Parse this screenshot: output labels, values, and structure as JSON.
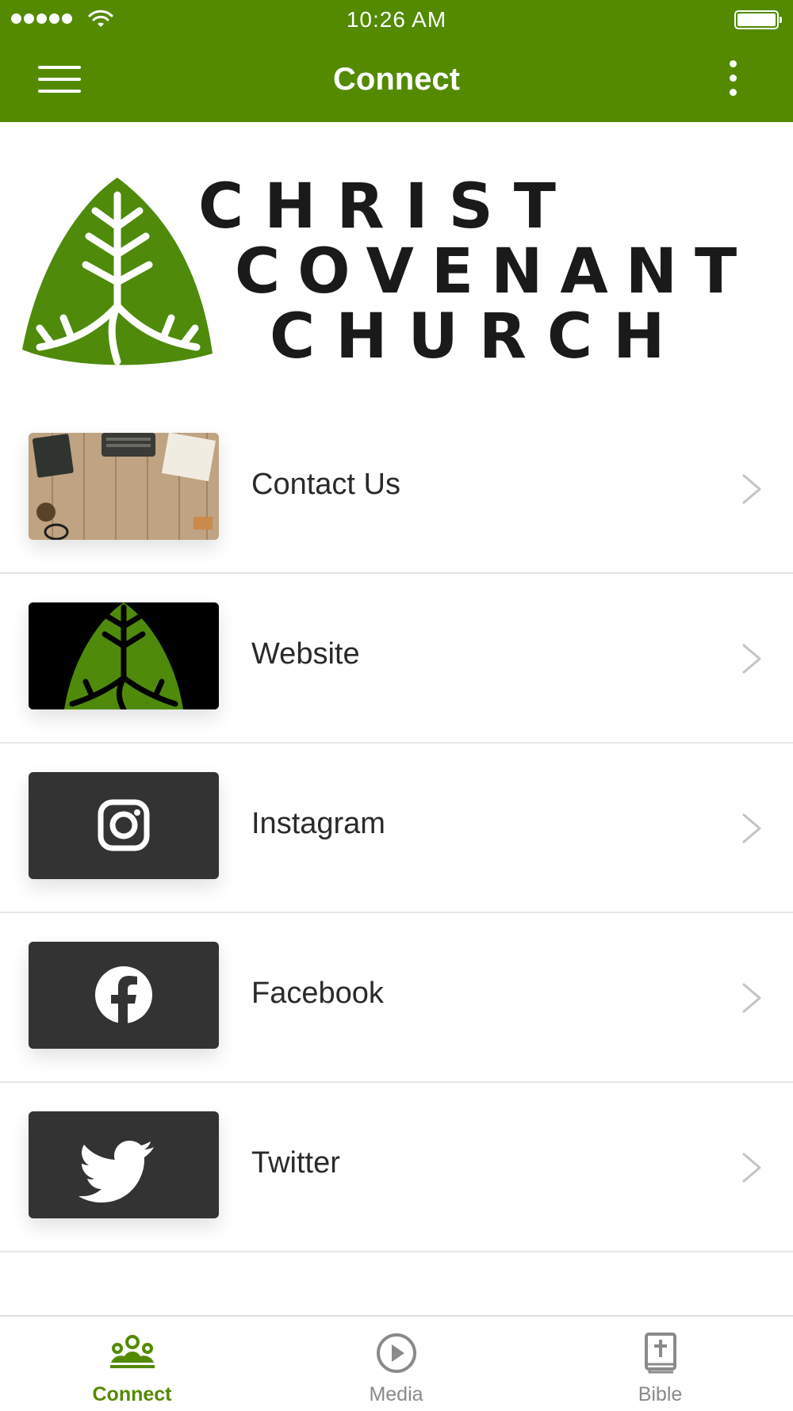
{
  "status_bar": {
    "time": "10:26 AM",
    "icons": [
      "signal-dots-icon",
      "wifi-icon",
      "battery-icon"
    ]
  },
  "header": {
    "title": "Connect",
    "left_icon": "menu-icon",
    "right_icon": "more-vertical-icon",
    "background_color": "#538a00"
  },
  "logo": {
    "words": [
      "CHRIST",
      "COVENANT",
      "CHURCH"
    ],
    "accent_color": "#4f8a0b"
  },
  "list": {
    "items": [
      {
        "label": "Contact Us",
        "thumbnail": "desk-photo"
      },
      {
        "label": "Website",
        "thumbnail": "leaf-logo"
      },
      {
        "label": "Instagram",
        "thumbnail": "instagram-icon"
      },
      {
        "label": "Facebook",
        "thumbnail": "facebook-icon"
      },
      {
        "label": "Twitter",
        "thumbnail": "twitter-icon"
      }
    ]
  },
  "tabbar": {
    "tabs": [
      {
        "label": "Connect",
        "icon": "people-icon",
        "active": true
      },
      {
        "label": "Media",
        "icon": "play-circle-icon",
        "active": false
      },
      {
        "label": "Bible",
        "icon": "bible-icon",
        "active": false
      }
    ],
    "active_color": "#538a00",
    "inactive_color": "#8a8a8a"
  }
}
